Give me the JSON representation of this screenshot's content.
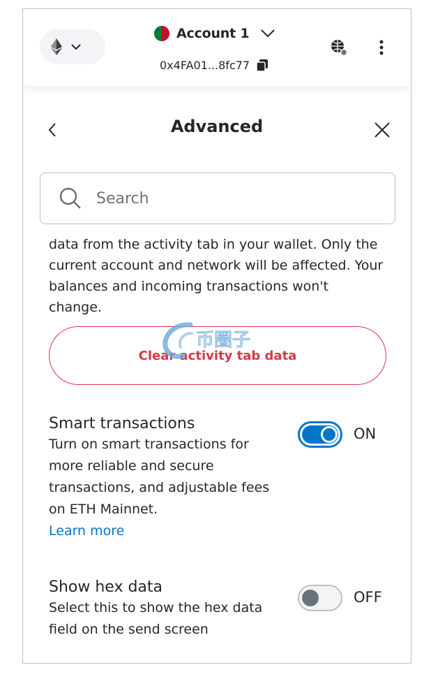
{
  "header": {
    "account_name": "Account 1",
    "address": "0x4FA01...8fc77"
  },
  "page": {
    "title": "Advanced"
  },
  "search": {
    "placeholder": "Search"
  },
  "activity": {
    "description": "data from the activity tab in your wallet. Only the current account and network will be affected. Your balances and incoming transactions won't change.",
    "clear_button": "Clear activity tab data"
  },
  "smart_transactions": {
    "title": "Smart transactions",
    "description": "Turn on smart transactions for more reliable and secure transactions, and adjustable fees on ETH Mainnet.",
    "learn_more": "Learn more",
    "state": "ON"
  },
  "hex_data": {
    "title": "Show hex data",
    "description": "Select this to show the hex data field on the send screen",
    "state": "OFF"
  },
  "watermark": {
    "text": "币圈子"
  },
  "colors": {
    "accent": "#0376c9",
    "danger": "#d73847"
  }
}
